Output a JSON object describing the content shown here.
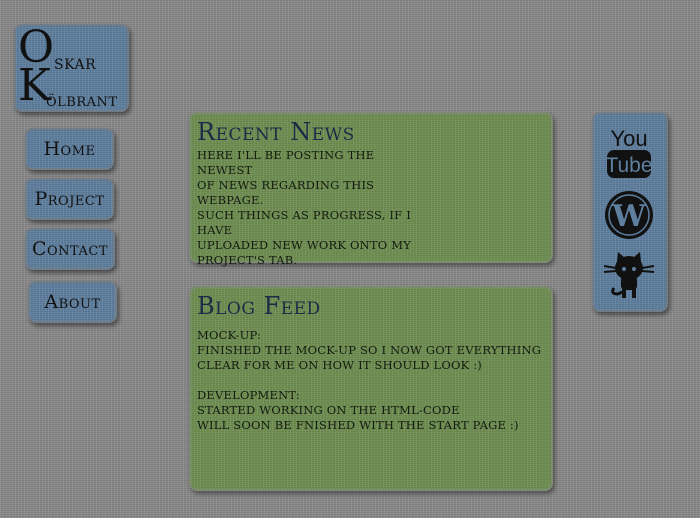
{
  "logo": {
    "line1_initial": "O",
    "line1_rest": "skar",
    "line2_initial": "K",
    "line2_rest": "ölbrant"
  },
  "nav": {
    "home": "Home",
    "project": "Project",
    "contact": "Contact",
    "about": "About"
  },
  "news": {
    "title": "Recent News",
    "lines": [
      "Here I'll be posting the newest",
      "of news regarding this webpage.",
      "Such things as progress, if I have",
      "uploaded new work onto my",
      "project's tab."
    ]
  },
  "blog": {
    "title": "Blog Feed",
    "entries": [
      {
        "heading": "Mock-up:",
        "lines": [
          "Finished the mock-up so I now got everything",
          "clear for me on how it should look :)"
        ]
      },
      {
        "heading": "Development:",
        "lines": [
          "Started working on the HTML-code",
          "will soon be fnished with the start page :)"
        ]
      }
    ]
  },
  "social": {
    "youtube_top": "You",
    "youtube_bottom": "Tube",
    "icons": [
      "youtube-icon",
      "wordpress-icon",
      "github-icon"
    ]
  },
  "colors": {
    "background": "#8a8a8a",
    "blue_box": "#5e7f9e",
    "green_box": "#6f8f52",
    "heading_text": "#1d2a45"
  }
}
